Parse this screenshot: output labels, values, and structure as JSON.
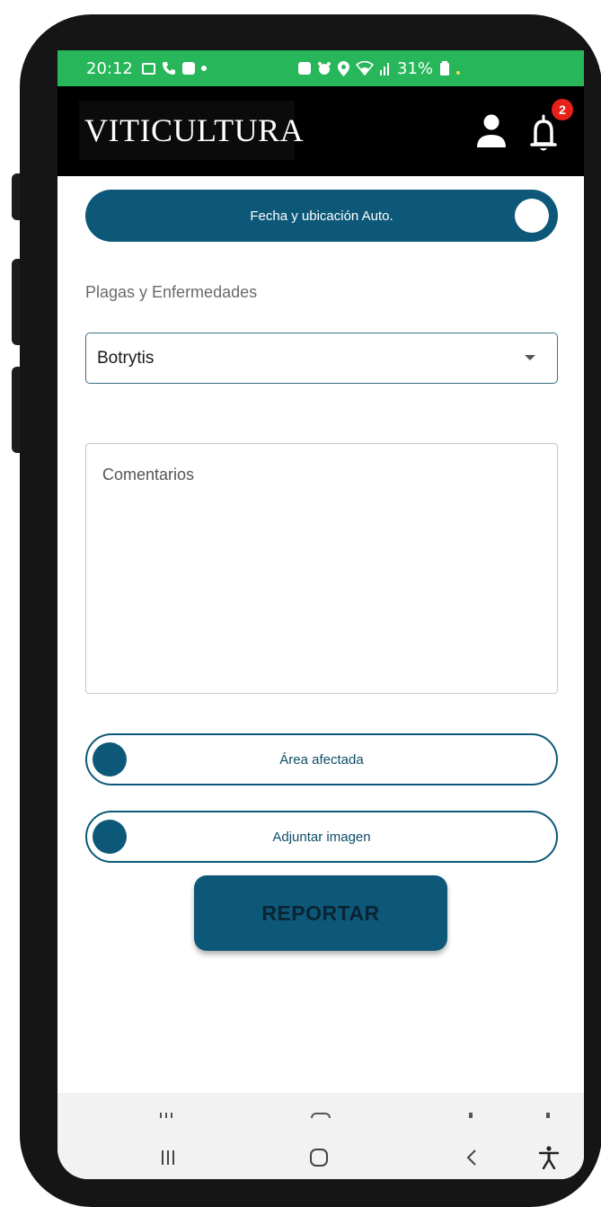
{
  "status_bar": {
    "time": "20:12",
    "battery": "31%",
    "background_color": "#27b65a"
  },
  "header": {
    "brand": "VITICULTURA",
    "notification_count": "2",
    "icons": [
      "person-icon",
      "bell-icon"
    ]
  },
  "form": {
    "auto_toggle_label": "Fecha y ubicación Auto.",
    "pests_label": "Plagas y Enfermedades",
    "pest_selected": "Botrytis",
    "comments_placeholder": "Comentarios",
    "affected_area_label": "Área afectada",
    "attach_image_label": "Adjuntar imagen",
    "report_button_label": "REPORTAR",
    "accent_color": "#0d5878"
  },
  "nav_bar": {
    "icons": [
      "recent-apps-icon",
      "home-icon",
      "back-icon",
      "accessibility-icon"
    ]
  }
}
